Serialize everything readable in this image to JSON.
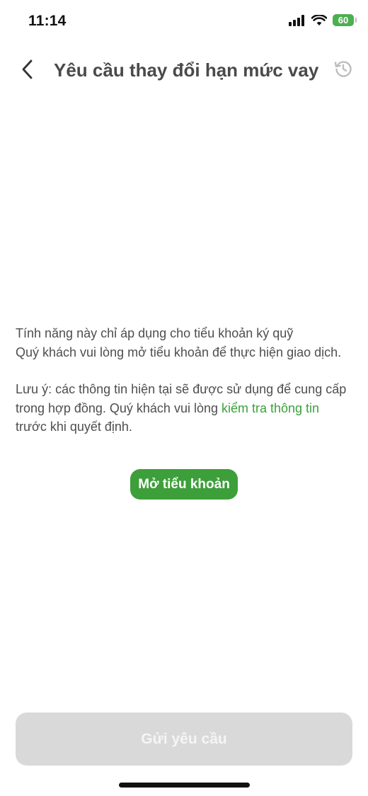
{
  "status_bar": {
    "time": "11:14",
    "battery": "60",
    "icons": [
      "signal-icon",
      "wifi-icon",
      "battery-icon"
    ]
  },
  "header": {
    "title": "Yêu cầu thay đổi hạn mức vay",
    "back_icon": "back-chevron-icon",
    "history_icon": "history-icon"
  },
  "content": {
    "paragraph1_line1": "Tính năng này chỉ áp dụng cho tiểu khoản ký quỹ",
    "paragraph1_line2": "Quý khách vui lòng mở tiểu khoản để thực hiện giao dịch.",
    "note_before": "Lưu ý: các thông tin hiện tại sẽ được sử dụng để cung cấp trong hợp đồng. Quý khách vui lòng ",
    "note_link": "kiểm tra thông tin",
    "note_after": " trước khi quyết định.",
    "open_button": "Mở tiểu khoản"
  },
  "footer": {
    "submit_button": "Gửi yêu cầu"
  },
  "colors": {
    "accent_green": "#3d9f3a",
    "disabled_button": "#d9d9d9",
    "text": "#4e4e4e"
  }
}
